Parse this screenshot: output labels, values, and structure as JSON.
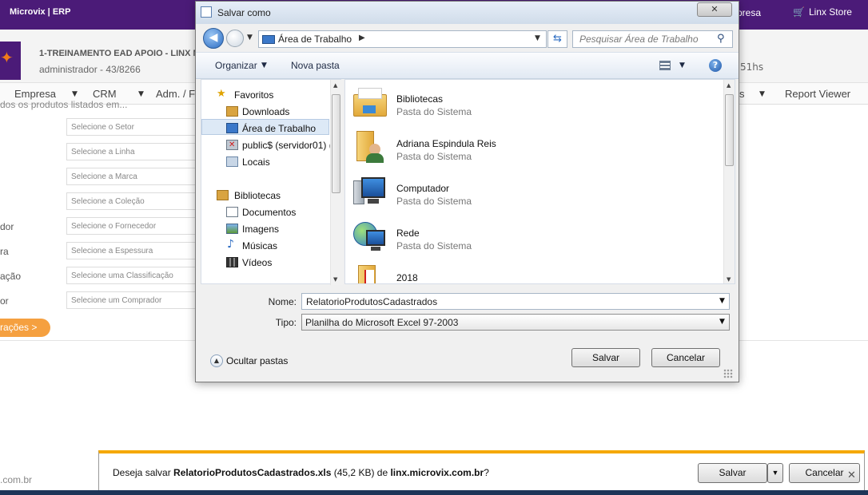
{
  "app": {
    "brand": "Microvix | ERP",
    "empresa_link": "presa",
    "store_link": "Linx Store",
    "company_name": "1-TREINAMENTO EAD APOIO - LINX M",
    "user_line": "administrador - 43/8266",
    "time_fragment": "51hs",
    "menu": [
      "Empresa",
      "CRM",
      "Adm. / F",
      "s",
      "Report Viewer"
    ],
    "hint": "dos os produtos listados em...",
    "filters": [
      {
        "label": "",
        "placeholder": "Selecione o Setor"
      },
      {
        "label": "",
        "placeholder": "Selecione a Linha"
      },
      {
        "label": "",
        "placeholder": "Selecione a Marca"
      },
      {
        "label": "",
        "placeholder": "Selecione a Coleção"
      },
      {
        "label": "dor",
        "placeholder": "Selecione o Fornecedor"
      },
      {
        "label": "ra",
        "placeholder": "Selecione a Espessura"
      },
      {
        "label": "ação",
        "placeholder": "Selecione uma Classificação"
      },
      {
        "label": "or",
        "placeholder": "Selecione um Comprador"
      }
    ],
    "config_button": "rações >",
    "footer_url": ".com.br"
  },
  "dialog": {
    "title": "Salvar como",
    "close": "✕",
    "address": "Área de Trabalho",
    "search_placeholder": "Pesquisar Área de Trabalho",
    "organize": "Organizar",
    "new_folder": "Nova pasta",
    "help": "?",
    "nav": {
      "favorites_header": "Favoritos",
      "favorites": [
        "Downloads",
        "Área de Trabalho",
        "public$ (servidor01) (",
        "Locais"
      ],
      "libraries_header": "Bibliotecas",
      "libraries": [
        "Documentos",
        "Imagens",
        "Músicas",
        "Vídeos"
      ]
    },
    "files": [
      {
        "name": "Bibliotecas",
        "type": "Pasta do Sistema",
        "icon": "libraries-folder-icon"
      },
      {
        "name": "Adriana Espindula Reis",
        "type": "Pasta do Sistema",
        "icon": "user-folder-icon"
      },
      {
        "name": "Computador",
        "type": "Pasta do Sistema",
        "icon": "computer-icon"
      },
      {
        "name": "Rede",
        "type": "Pasta do Sistema",
        "icon": "network-icon"
      },
      {
        "name": "2018",
        "type": "",
        "icon": "folder-icon"
      }
    ],
    "name_label": "Nome:",
    "name_value": "RelatorioProdutosCadastrados",
    "type_label": "Tipo:",
    "type_value": "Planilha do Microsoft Excel 97-2003",
    "hide_folders": "Ocultar pastas",
    "save": "Salvar",
    "cancel": "Cancelar"
  },
  "download_bar": {
    "prefix": "Deseja salvar ",
    "filename": "RelatorioProdutosCadastrados.xls",
    "size": " (45,2 KB) de ",
    "site": "linx.microvix.com.br",
    "suffix": "?",
    "save": "Salvar",
    "cancel": "Cancelar",
    "close": "✕"
  },
  "colors": {
    "brand_purple": "#4b1b78",
    "accent_orange": "#f5a040",
    "download_bar_accent": "#f5a800"
  }
}
